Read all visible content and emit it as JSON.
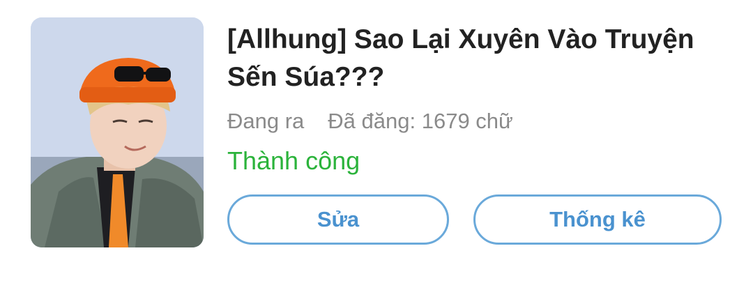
{
  "story": {
    "title": "[Allhung] Sao Lại Xuyên Vào Truyện Sến Súa???",
    "status": "Đang ra",
    "word_count_label": "Đã đăng: 1679 chữ",
    "publish_state": "Thành công",
    "publish_state_color": "#2bb33b"
  },
  "actions": {
    "edit_label": "Sửa",
    "stats_label": "Thống kê"
  },
  "colors": {
    "accent": "#4a92cf",
    "button_border": "#6aa9da",
    "title": "#222222",
    "meta": "#8a8a8a"
  },
  "cover": {
    "description_icon": "cover-image"
  }
}
